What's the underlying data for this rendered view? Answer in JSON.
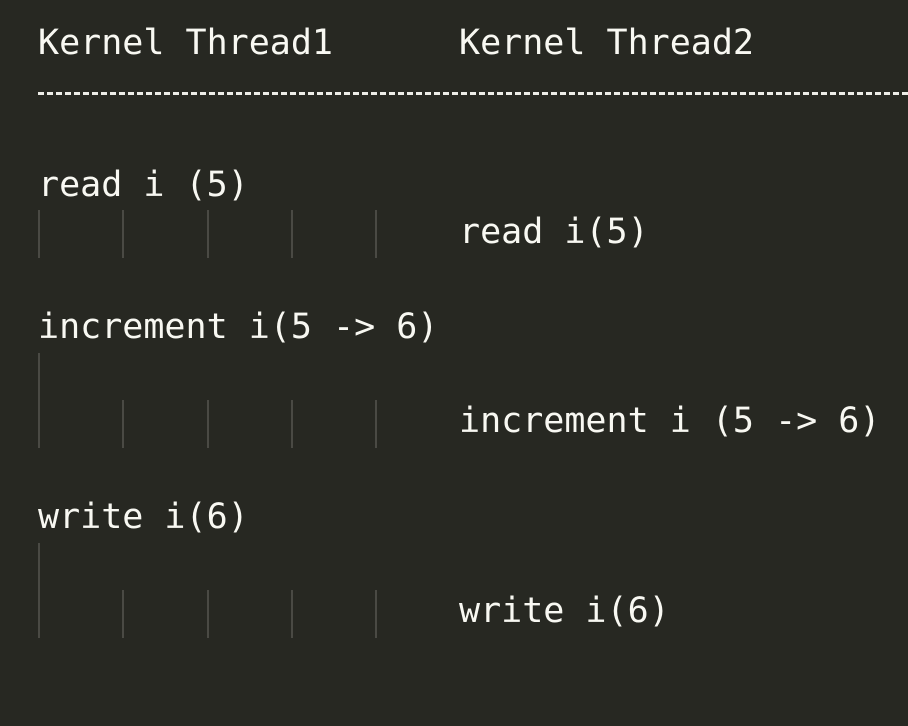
{
  "header": {
    "col1": "Kernel Thread1",
    "col2": "Kernel Thread2"
  },
  "rows": [
    {
      "thread1": "read i (5)"
    },
    {
      "thread2": "read i(5)"
    },
    {
      "thread1": "increment i(5 -> 6)"
    },
    {
      "thread2": "increment i (5 -> 6)"
    },
    {
      "thread1": "write i(6)"
    },
    {
      "thread2": "write i(6)"
    }
  ],
  "colors": {
    "background": "#272822",
    "text": "#f8f8f2",
    "indent_guide": "#4a4a44"
  }
}
